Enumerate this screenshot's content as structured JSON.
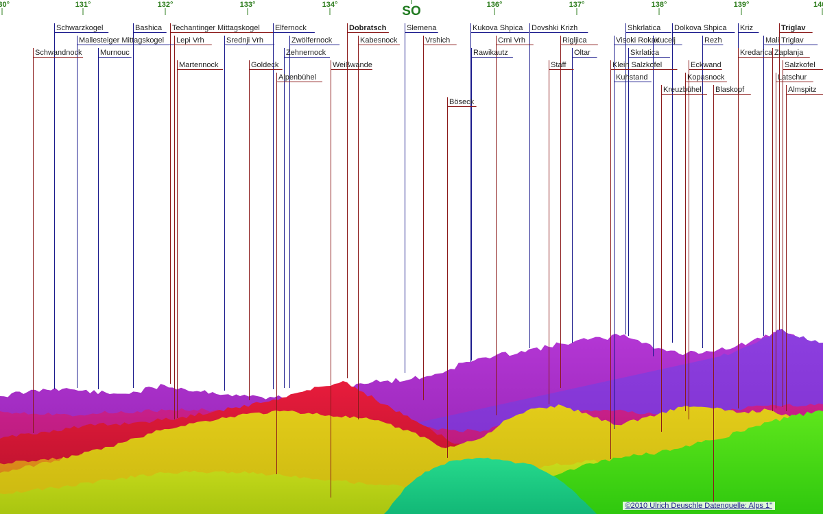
{
  "compass": {
    "direction": "SO",
    "degree_labels": [
      "130°",
      "131°",
      "132°",
      "133°",
      "134°",
      "136°",
      "137°",
      "138°",
      "139°",
      "140°"
    ]
  },
  "peaks": [
    {
      "name": "Schwarzkogel",
      "series": "blue"
    },
    {
      "name": "Bashica",
      "series": "blue"
    },
    {
      "name": "Techantinger Mittagskogel",
      "series": "red"
    },
    {
      "name": "Elfernock",
      "series": "blue"
    },
    {
      "name": "Dobratsch",
      "series": "red",
      "bold": true
    },
    {
      "name": "Slemena",
      "series": "blue"
    },
    {
      "name": "Kukova Shpica",
      "series": "blue"
    },
    {
      "name": "Dovshki Krizh",
      "series": "blue"
    },
    {
      "name": "Shkrlatica",
      "series": "blue"
    },
    {
      "name": "Dolkova Shpica",
      "series": "blue"
    },
    {
      "name": "Kriz",
      "series": "blue"
    },
    {
      "name": "Triglav",
      "series": "red",
      "bold": true
    },
    {
      "name": "Mallesteiger Mittagskogel",
      "series": "blue"
    },
    {
      "name": "Lepi Vrh",
      "series": "red"
    },
    {
      "name": "Srednji Vrh",
      "series": "blue"
    },
    {
      "name": "Zwölfernock",
      "series": "blue"
    },
    {
      "name": "Kabesnock",
      "series": "red"
    },
    {
      "name": "Vrshich",
      "series": "red"
    },
    {
      "name": "Crni Vrh",
      "series": "red"
    },
    {
      "name": "Rigljica",
      "series": "red"
    },
    {
      "name": "Visoki Rokav",
      "series": "blue"
    },
    {
      "name": "Kucelj",
      "series": "blue"
    },
    {
      "name": "Rezh",
      "series": "blue"
    },
    {
      "name": "Mali Triglav",
      "series": "blue"
    },
    {
      "name": "Schwandnock",
      "series": "red"
    },
    {
      "name": "Murnouc",
      "series": "blue"
    },
    {
      "name": "Zehnernock",
      "series": "blue"
    },
    {
      "name": "Rawikautz",
      "series": "blue"
    },
    {
      "name": "Oltar",
      "series": "blue"
    },
    {
      "name": "Skrlatica",
      "series": "blue"
    },
    {
      "name": "Kredarica",
      "series": "red"
    },
    {
      "name": "Zaplanja",
      "series": "red"
    },
    {
      "name": "Martennock",
      "series": "red"
    },
    {
      "name": "Goldeck",
      "series": "red"
    },
    {
      "name": "Weißwande",
      "series": "red"
    },
    {
      "name": "Staff",
      "series": "red"
    },
    {
      "name": "Klein Salzkofel",
      "series": "red"
    },
    {
      "name": "Eckwand",
      "series": "red"
    },
    {
      "name": "Salzkofel",
      "series": "red"
    },
    {
      "name": "Alpenbühel",
      "series": "red"
    },
    {
      "name": "Kuhstand",
      "series": "blue"
    },
    {
      "name": "Kopasnock",
      "series": "red"
    },
    {
      "name": "Latschur",
      "series": "red"
    },
    {
      "name": "Kreuzbühel",
      "series": "red"
    },
    {
      "name": "Blaskopf",
      "series": "red"
    },
    {
      "name": "Almspitz",
      "series": "red"
    },
    {
      "name": "Böseck",
      "series": "red"
    }
  ],
  "colors": {
    "degree": "#2e7d1e",
    "compass": "#1f7a1f",
    "line_blue": "#1a1a8c",
    "line_red": "#8b1a1a",
    "label_text": "#222222",
    "sky": "#ffffff"
  },
  "credit": {
    "text": "©2010 Ulrich Deuschle    Datenquelle: Alps 1\""
  }
}
